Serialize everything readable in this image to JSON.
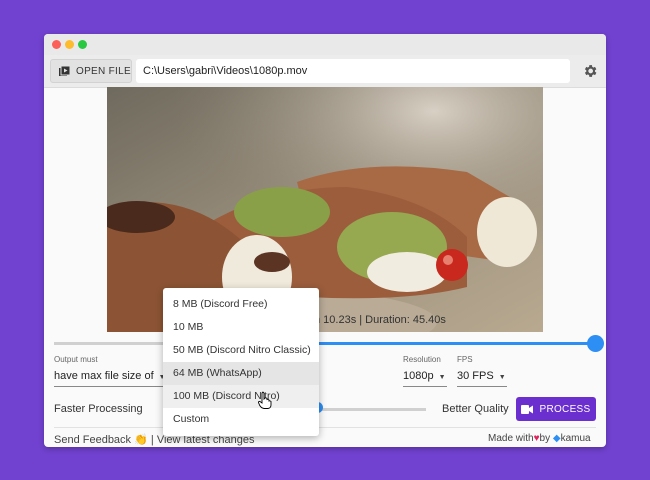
{
  "toolbar": {
    "open_file_label": "OPEN FILE",
    "file_path": "C:\\Users\\gabri\\Videos\\1080p.mov"
  },
  "preview": {
    "info_text": "n 10.23s | Duration: 45.40s"
  },
  "controls": {
    "output_label": "Output must",
    "output_value": "have max file size of",
    "resolution_label": "Resolution",
    "resolution_value": "1080p",
    "fps_label": "FPS",
    "fps_value": "30 FPS",
    "faster_label": "Faster Processing",
    "better_label": "Better Quality",
    "process_label": "PROCESS"
  },
  "footer": {
    "send_feedback": "Send Feedback",
    "feedback_emoji": "👏",
    "separator": "|",
    "view_changes": "View latest changes",
    "made_with": "Made with",
    "by": "by",
    "brand": "kamua"
  },
  "dropdown": {
    "options": [
      "8 MB (Discord Free)",
      "10 MB",
      "50 MB (Discord Nitro Classic)",
      "64 MB (WhatsApp)",
      "100 MB (Discord Nitro)",
      "Custom"
    ]
  },
  "colors": {
    "background": "#7142cf",
    "accent": "#2d8ef3",
    "process_button": "#6b2fd0"
  }
}
